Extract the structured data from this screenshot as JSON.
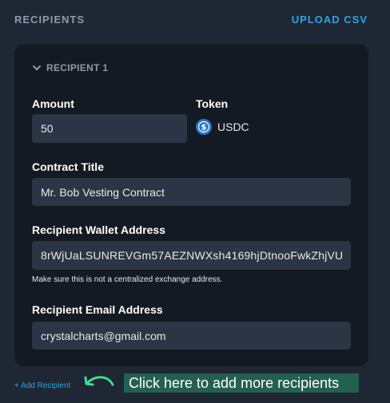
{
  "header": {
    "title": "RECIPIENTS",
    "upload_label": "UPLOAD CSV"
  },
  "recipient": {
    "section_label": "RECIPIENT 1",
    "amount": {
      "label": "Amount",
      "value": "50"
    },
    "token": {
      "label": "Token",
      "name": "USDC",
      "icon": "usdc-coin-icon"
    },
    "contract_title": {
      "label": "Contract Title",
      "value": "Mr. Bob Vesting Contract"
    },
    "wallet": {
      "label": "Recipient Wallet Address",
      "value": "8rWjUaLSUNREVGm57AEZNWXsh4169hjDtnooFwkZhjVU",
      "helper": "Make sure this is not a centralized exchange address."
    },
    "email": {
      "label": "Recipient Email Address",
      "value": "crystalcharts@gmail.com"
    }
  },
  "add_recipient_label": "+ Add Recipient",
  "callout_text": "Click here to add more recipients",
  "colors": {
    "page_bg": "#1e2733",
    "card_bg": "#131a22",
    "input_bg": "#2b3543",
    "accent_blue": "#2ea3e6",
    "muted_text": "#8e9aab",
    "arrow_green": "#3ddc97",
    "callout_bg": "#23604f",
    "usdc_blue": "#2775ca"
  }
}
